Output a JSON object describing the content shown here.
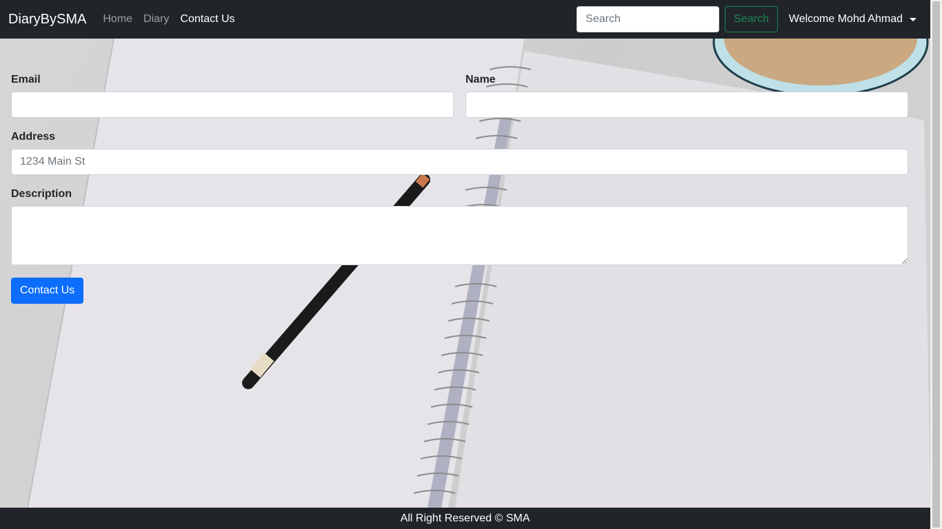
{
  "navbar": {
    "brand": "DiaryBySMA",
    "links": [
      {
        "label": "Home"
      },
      {
        "label": "Diary"
      },
      {
        "label": "Contact Us"
      }
    ],
    "search": {
      "placeholder": "Search",
      "value": "",
      "button_label": "Search"
    },
    "user_menu": {
      "label": "Welcome Mohd Ahmad",
      "icon": "caret-down-icon"
    }
  },
  "form": {
    "email": {
      "label": "Email",
      "value": "",
      "placeholder": ""
    },
    "name": {
      "label": "Name",
      "value": "",
      "placeholder": ""
    },
    "address": {
      "label": "Address",
      "value": "",
      "placeholder": "1234 Main St"
    },
    "description": {
      "label": "Description",
      "value": "",
      "placeholder": ""
    },
    "submit_label": "Contact Us"
  },
  "footer": {
    "text": "All Right Reserved © SMA"
  },
  "colors": {
    "navbar_bg": "#212529",
    "primary": "#0d6efd",
    "success": "#198754"
  }
}
